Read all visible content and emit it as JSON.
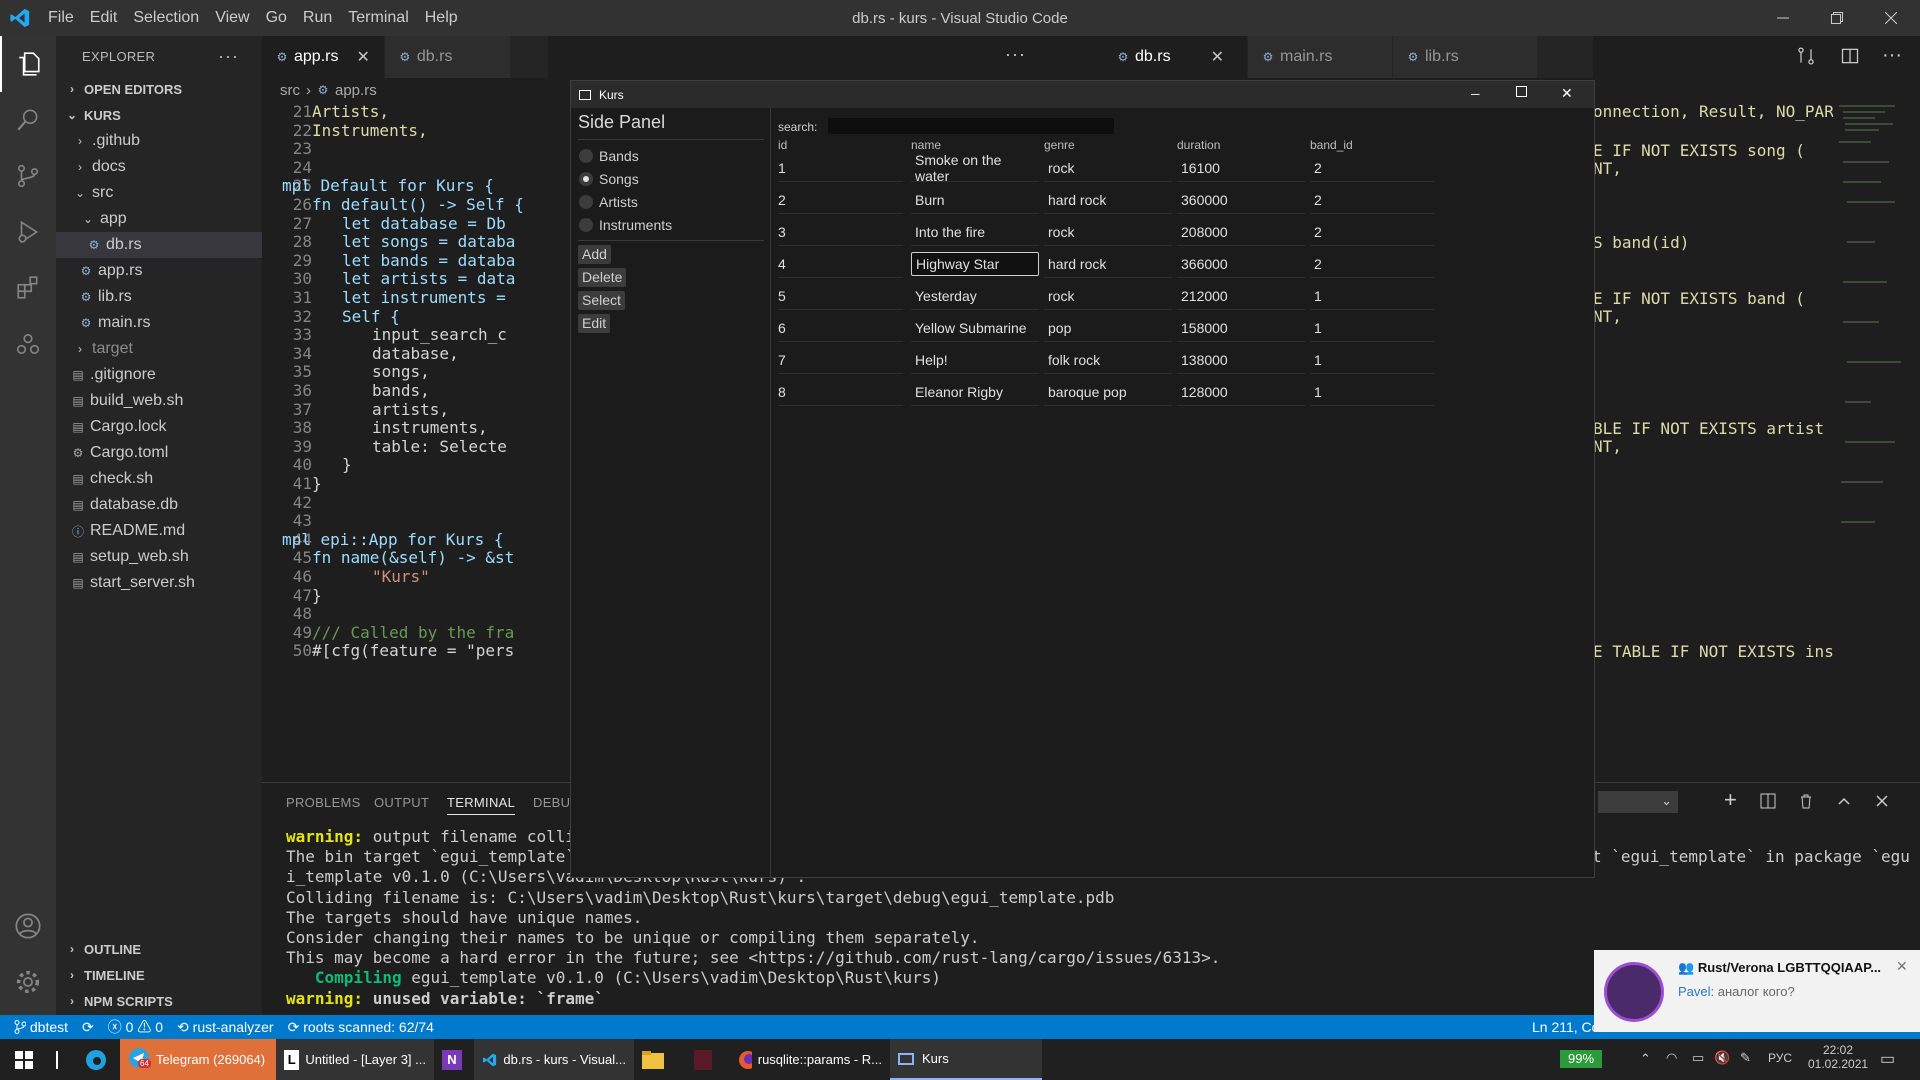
{
  "titlebar": {
    "menus": [
      "File",
      "Edit",
      "Selection",
      "View",
      "Go",
      "Run",
      "Terminal",
      "Help"
    ],
    "title": "db.rs - kurs - Visual Studio Code"
  },
  "explorer": {
    "header": "EXPLORER",
    "open_editors": "OPEN EDITORS",
    "project": "KURS",
    "items": [
      {
        "label": ".github",
        "type": "folder"
      },
      {
        "label": "docs",
        "type": "folder"
      },
      {
        "label": "src",
        "type": "folder-open"
      },
      {
        "label": "app",
        "type": "folder-open"
      },
      {
        "label": "db.rs",
        "type": "rust"
      },
      {
        "label": "app.rs",
        "type": "rust"
      },
      {
        "label": "lib.rs",
        "type": "rust"
      },
      {
        "label": "main.rs",
        "type": "rust"
      },
      {
        "label": "target",
        "type": "folder"
      },
      {
        "label": ".gitignore",
        "type": "file"
      },
      {
        "label": "build_web.sh",
        "type": "file"
      },
      {
        "label": "Cargo.lock",
        "type": "file"
      },
      {
        "label": "Cargo.toml",
        "type": "gear"
      },
      {
        "label": "check.sh",
        "type": "file"
      },
      {
        "label": "database.db",
        "type": "file"
      },
      {
        "label": "README.md",
        "type": "info"
      },
      {
        "label": "setup_web.sh",
        "type": "file"
      },
      {
        "label": "start_server.sh",
        "type": "file"
      }
    ],
    "outline": "OUTLINE",
    "timeline": "TIMELINE",
    "npm": "NPM SCRIPTS"
  },
  "editor_left": {
    "tabs": [
      "app.rs",
      "db.rs"
    ],
    "breadcrumb": [
      "src",
      "app.rs"
    ],
    "line_numbers": [
      "21",
      "22",
      "23",
      "24",
      "25",
      "26",
      "27",
      "28",
      "29",
      "30",
      "31",
      "32",
      "33",
      "34",
      "35",
      "36",
      "37",
      "38",
      "39",
      "40",
      "41",
      "42",
      "43",
      "44",
      "45",
      "46",
      "47",
      "48",
      "49",
      "50"
    ],
    "lines": [
      "Artists,",
      "Instruments,",
      "",
      "",
      "mpl Default for Kurs {",
      "fn default() -> Self {",
      "let database = Db",
      "let songs = databa",
      "let bands = databa",
      "let artists = data",
      "let instruments = ",
      "Self {",
      "input_search_c",
      "database,",
      "songs,",
      "bands,",
      "artists,",
      "instruments,",
      "table: Selecte",
      "}",
      "}",
      "",
      "",
      "mpl epi::App for Kurs {",
      "fn name(&self) -> &st",
      "\"Kurs\"",
      "}",
      "",
      "/// Called by the fra",
      "#[cfg(feature = \"pers"
    ]
  },
  "editor_right": {
    "tabs": [
      "db.rs",
      "main.rs",
      "lib.rs"
    ],
    "lines": [
      "onnection, Result, NO_PAR",
      "E IF NOT EXISTS song (",
      "NT,",
      "S band(id)",
      "E IF NOT EXISTS band (",
      "NT,",
      "BLE IF NOT EXISTS artist (",
      "NT,",
      "E TABLE IF NOT EXISTS ins"
    ]
  },
  "panel": {
    "tabs": [
      "PROBLEMS",
      "OUTPUT",
      "TERMINAL",
      "DEBU"
    ],
    "terminal": [
      {
        "prefix": "warning:",
        "text": " output filename collis",
        "tail": ""
      },
      {
        "prefix": "",
        "text": "The bin target `egui_template` i",
        "tail": "t `egui_template` in package `egu"
      },
      {
        "prefix": "",
        "text": "i_template v0.1.0 (C:\\Users\\vadim\\Desktop\\Rust\\kurs)`.",
        "tail": ""
      },
      {
        "prefix": "",
        "text": "Colliding filename is: C:\\Users\\vadim\\Desktop\\Rust\\kurs\\target\\debug\\egui_template.pdb",
        "tail": ""
      },
      {
        "prefix": "",
        "text": "The targets should have unique names.",
        "tail": ""
      },
      {
        "prefix": "",
        "text": "Consider changing their names to be unique or compiling them separately.",
        "tail": ""
      },
      {
        "prefix": "",
        "text": "This may become a hard error in the future; see <https://github.com/rust-lang/cargo/issues/6313>.",
        "tail": ""
      },
      {
        "prefix": "   Compiling",
        "text": " egui_template v0.1.0 (C:\\Users\\vadim\\Desktop\\Rust\\kurs)",
        "tail": ""
      },
      {
        "prefix": "warning:",
        "text": " unused variable: `frame`",
        "tail": ""
      }
    ]
  },
  "statusbar": {
    "branch": "dbtest",
    "errors": "0",
    "warnings": "0",
    "analyzer": "rust-analyzer",
    "roots": "roots scanned: 62/74",
    "position": "Ln 211, Co"
  },
  "kurs_app": {
    "title": "Kurs",
    "side_panel_title": "Side Panel",
    "radio_options": [
      "Bands",
      "Songs",
      "Artists",
      "Instruments"
    ],
    "selected_option": "Songs",
    "buttons": [
      "Add",
      "Delete",
      "Select",
      "Edit"
    ],
    "search_label": "search:",
    "search_value": "",
    "columns": [
      "id",
      "name",
      "genre",
      "duration",
      "band_id"
    ],
    "rows": [
      [
        "1",
        "Smoke on the water",
        "rock",
        "16100",
        "2"
      ],
      [
        "2",
        "Burn",
        "hard rock",
        "360000",
        "2"
      ],
      [
        "3",
        "Into the fire",
        "rock",
        "208000",
        "2"
      ],
      [
        "4",
        "Highway Star",
        "hard rock",
        "366000",
        "2"
      ],
      [
        "5",
        "Yesterday",
        "rock",
        "212000",
        "1"
      ],
      [
        "6",
        "Yellow Submarine",
        "pop",
        "158000",
        "1"
      ],
      [
        "7",
        "Help!",
        "folk rock",
        "138000",
        "1"
      ],
      [
        "8",
        "Eleanor Rigby",
        "baroque pop",
        "128000",
        "1"
      ]
    ],
    "selected_cell": "Highway Star"
  },
  "notification": {
    "title": "Rust/Verona LGBTTQQIAAP...",
    "sender": "Pavel:",
    "message": " аналог кого?"
  },
  "taskbar": {
    "items": [
      "Telegram (269064)",
      "Untitled - [Layer 3] ...",
      "db.rs - kurs - Visual...",
      "rusqlite::params - R...",
      "Kurs"
    ],
    "badge": "64",
    "battery": "99%",
    "lang": "РУС",
    "time": "22:02",
    "date": "01.02.2021"
  },
  "colors": {
    "accent": "#007acc",
    "titlebar": "#323233",
    "sidebar": "#252526",
    "editor": "#1e1e1e",
    "egui_bg": "#1b1b1b"
  }
}
